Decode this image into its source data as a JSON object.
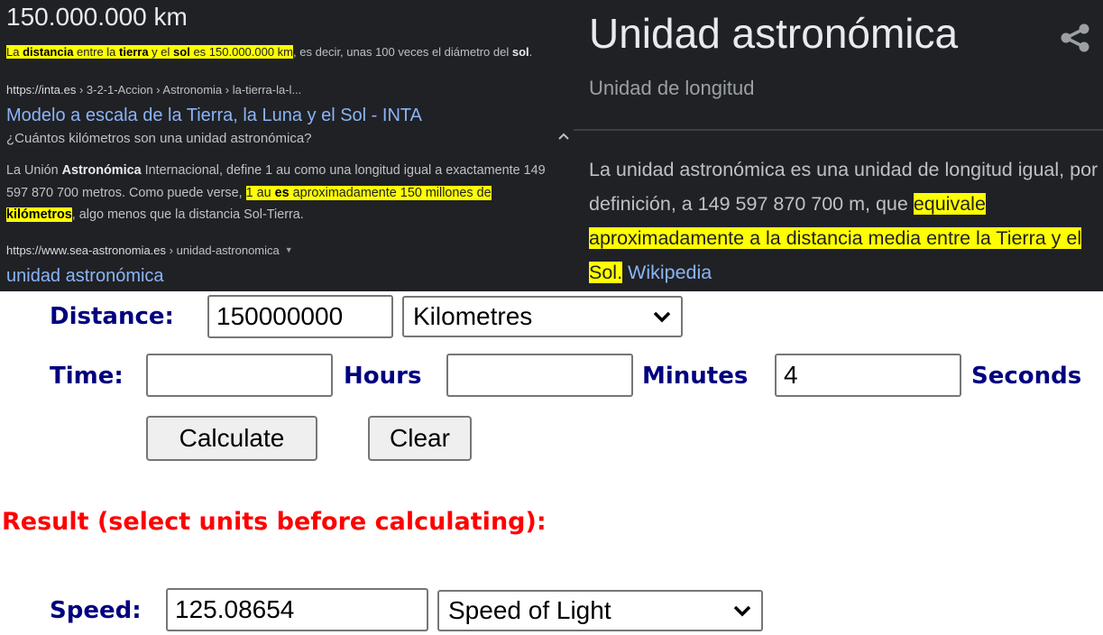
{
  "search_results": {
    "featured_answer": "150.000.000 km",
    "featured_snippet": {
      "highlighted_parts": [
        {
          "text": "La ",
          "bold": false
        },
        {
          "text": "distancia",
          "bold": true
        },
        {
          "text": " entre la ",
          "bold": false
        },
        {
          "text": "tierra",
          "bold": true
        },
        {
          "text": " y el ",
          "bold": false
        },
        {
          "text": "sol",
          "bold": true
        },
        {
          "text": " es 150.000.000 km",
          "bold": false
        }
      ],
      "rest_before_bold": ", es decir, unas 100 veces el diámetro del ",
      "rest_bold": "sol",
      "rest_end": "."
    },
    "result1": {
      "cite_host": "https://inta.es",
      "cite_path": " › 3-2-1-Accion › Astronomia › la-tierra-la-l...",
      "title": "Modelo a escala de la Tierra, la Luna y el Sol - INTA"
    },
    "related_question": {
      "question": "¿Cuántos kilómetros son una unidad astronómica?",
      "expanded": true,
      "answer_p1": "La Unión ",
      "answer_b1": "Astronómica",
      "answer_p2": " Internacional, define 1 au como una longitud igual a exactamente 149 597 870 700 metros. Como puede verse, ",
      "answer_hl1": "1 au ",
      "answer_hl_b1": "es",
      "answer_hl2": " aproximadamente 150 millones de",
      "answer_hl_b2": "kilómetros",
      "answer_end": ", algo menos que la distancia Sol-Tierra."
    },
    "result2": {
      "cite_host": "https://www.sea-astronomia.es",
      "cite_path": " › unidad-astronomica",
      "title": "unidad astronómica"
    }
  },
  "knowledge_panel": {
    "title": "Unidad astronómica",
    "subtitle": "Unidad de longitud",
    "share_icon": "share-icon",
    "description_plain": "La unidad astronómica es una unidad de longitud igual, por definición, a 149 597 870 700 m,  que ",
    "description_highlight": "equivale aproximadamente a la distancia media entre la Tierra y el Sol.",
    "source_link": "Wikipedia"
  },
  "calculator": {
    "distance_label": "Distance:",
    "distance_value": "150000000",
    "distance_unit": "Kilometres",
    "time_label": "Time:",
    "hours_value": "",
    "hours_label": "Hours",
    "minutes_value": "",
    "minutes_label": "Minutes",
    "seconds_value": "4",
    "seconds_label": "Seconds",
    "calculate_button": "Calculate",
    "clear_button": "Clear",
    "result_heading": "Result (select units before calculating):",
    "speed_label": "Speed:",
    "speed_value": "125.08654",
    "speed_unit": "Speed of Light"
  },
  "colors": {
    "dark_bg": "#202124",
    "link_blue": "#8ab4f8",
    "highlight": "#ffff00",
    "form_label": "#000080",
    "result_red": "#ff0000"
  }
}
